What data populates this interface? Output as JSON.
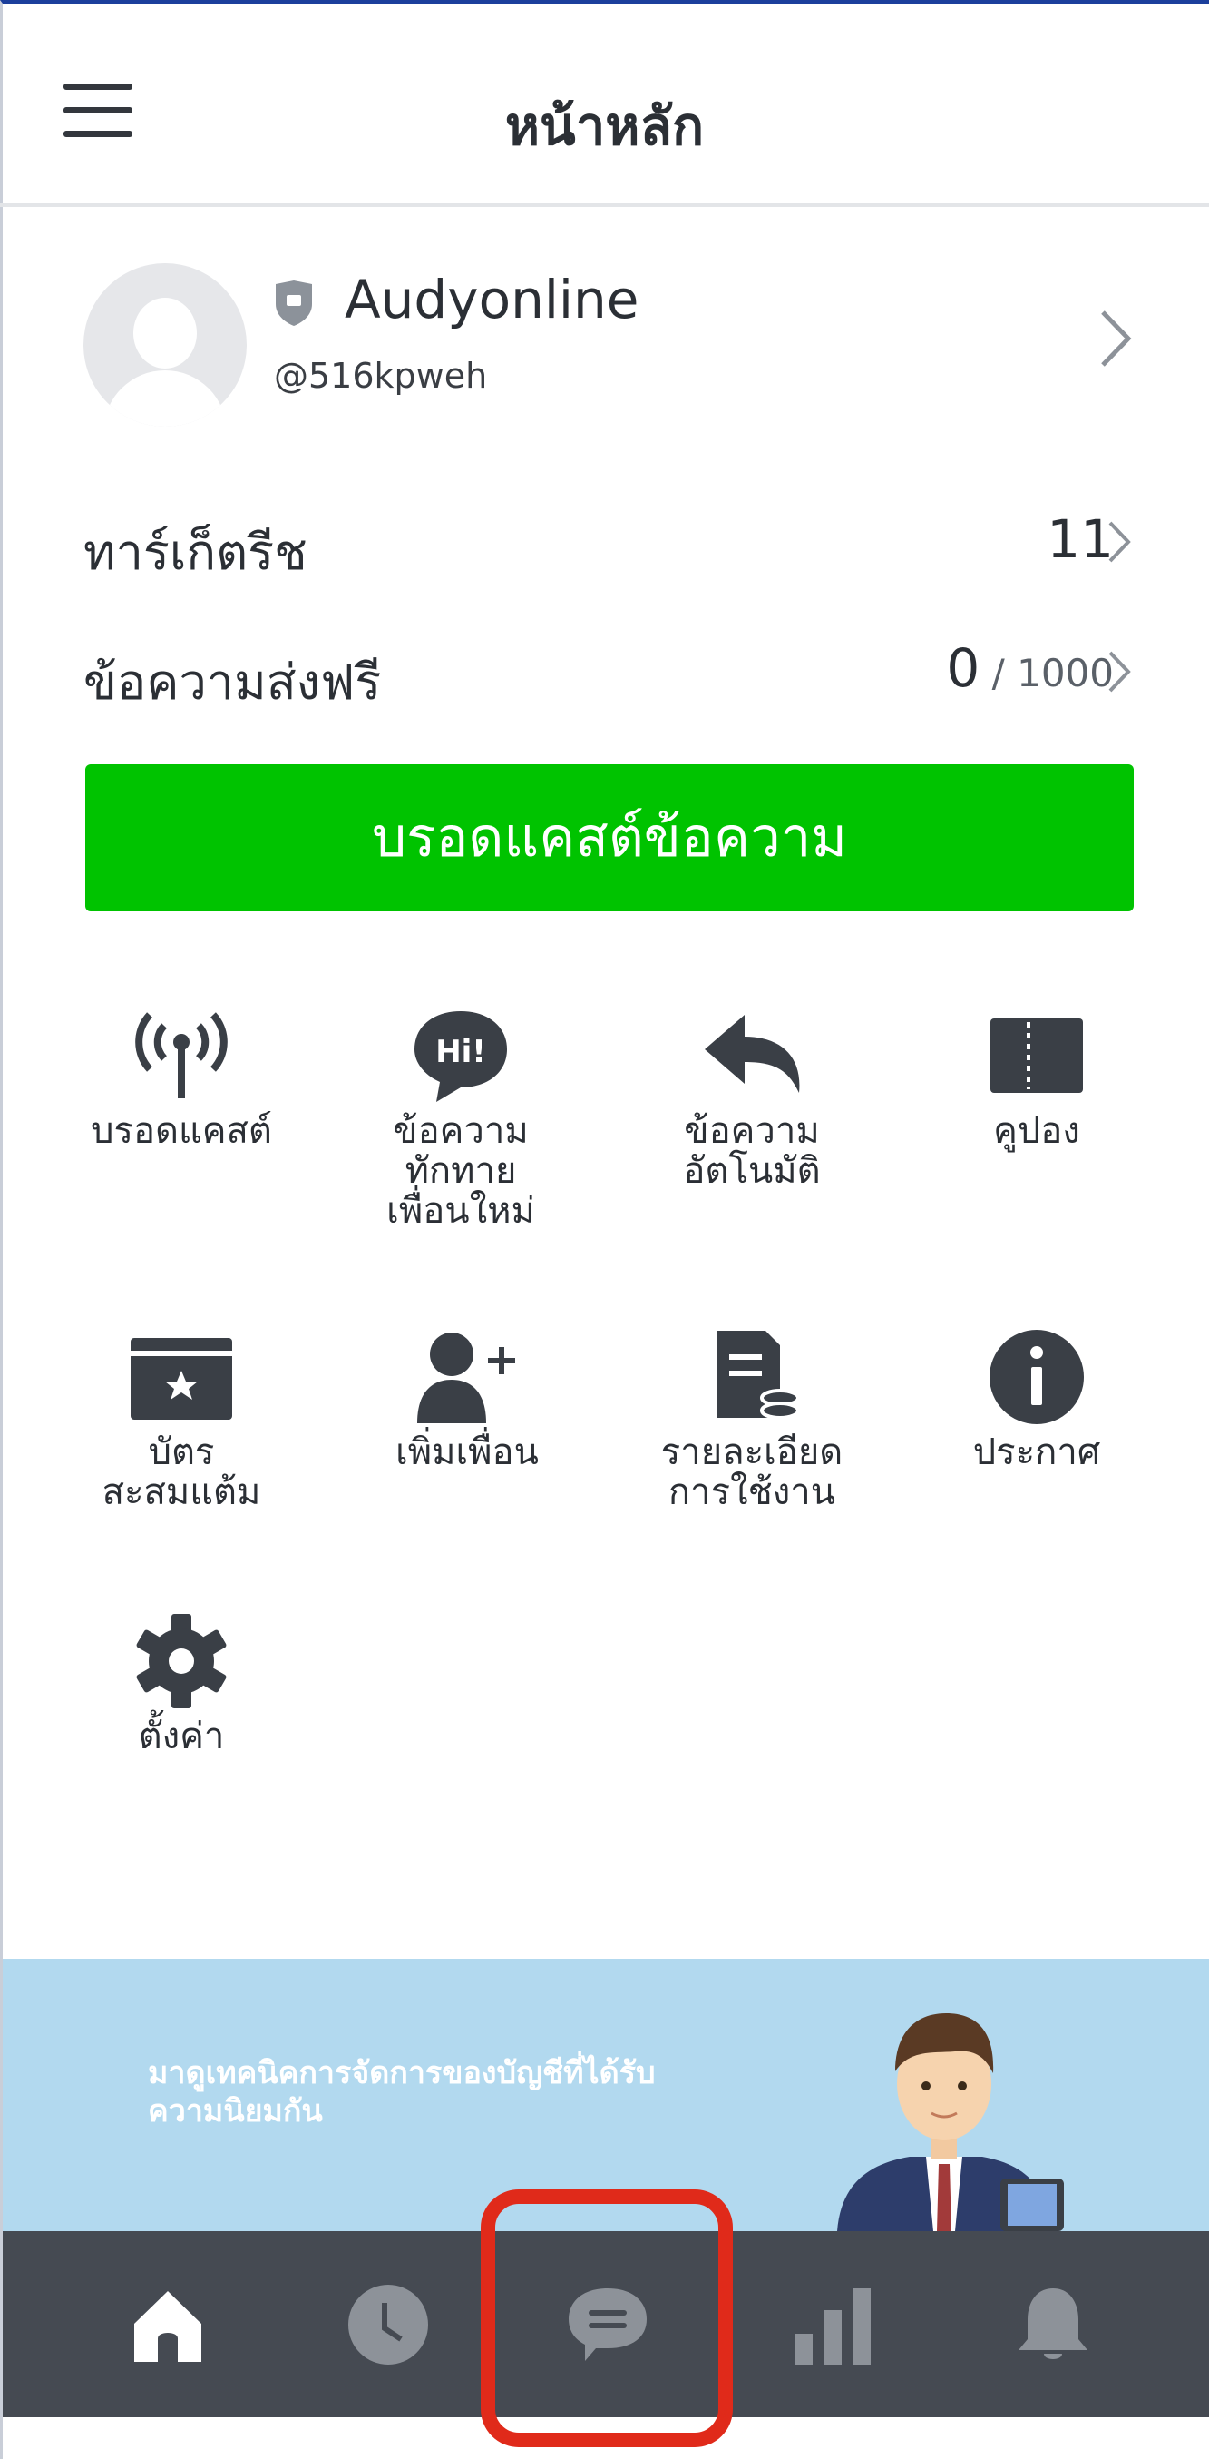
{
  "header": {
    "title": "หน้าหลัก",
    "menu_icon": "hamburger-menu-icon"
  },
  "profile": {
    "name": "Audyonline",
    "handle": "@516kpweh",
    "badge_icon": "shield-icon"
  },
  "stats": [
    {
      "label": "ทาร์เก็ตรีช",
      "value": "11"
    },
    {
      "label": "ข้อความส่งฟรี",
      "value": "0",
      "sub": " / 1000"
    }
  ],
  "broadcast_button": "บรอดแคสต์ข้อความ",
  "features": [
    {
      "icon": "antenna-icon",
      "label": "บรอดแคสต์"
    },
    {
      "icon": "greeting-hi-bubble-icon",
      "label": "ข้อความ\nทักทาย\nเพื่อนใหม่"
    },
    {
      "icon": "reply-arrow-icon",
      "label": "ข้อความ\nอัตโนมัติ"
    },
    {
      "icon": "coupon-icon",
      "label": "คูปอง"
    },
    {
      "icon": "reward-card-icon",
      "label": "บัตร\nสะสมแต้ม"
    },
    {
      "icon": "add-friend-icon",
      "label": "เพิ่มเพื่อน"
    },
    {
      "icon": "usage-report-icon",
      "label": "รายละเอียด\nการใช้งาน"
    },
    {
      "icon": "info-icon",
      "label": "ประกาศ"
    },
    {
      "icon": "gear-icon",
      "label": "ตั้งค่า"
    }
  ],
  "banner": {
    "text": "มาดูเทคนิคการจัดการของบัญชีที่ได้รับ\nความนิยมกัน"
  },
  "nav": [
    {
      "icon": "home-icon",
      "active": true
    },
    {
      "icon": "clock-icon",
      "active": false
    },
    {
      "icon": "chat-icon",
      "active": false
    },
    {
      "icon": "bar-chart-icon",
      "active": false
    },
    {
      "icon": "bell-icon",
      "active": false
    }
  ],
  "colors": {
    "brand_green": "#00c300",
    "nav_bg": "#454a52",
    "banner_bg": "#b2d9ef",
    "highlight": "#e02a1a"
  }
}
